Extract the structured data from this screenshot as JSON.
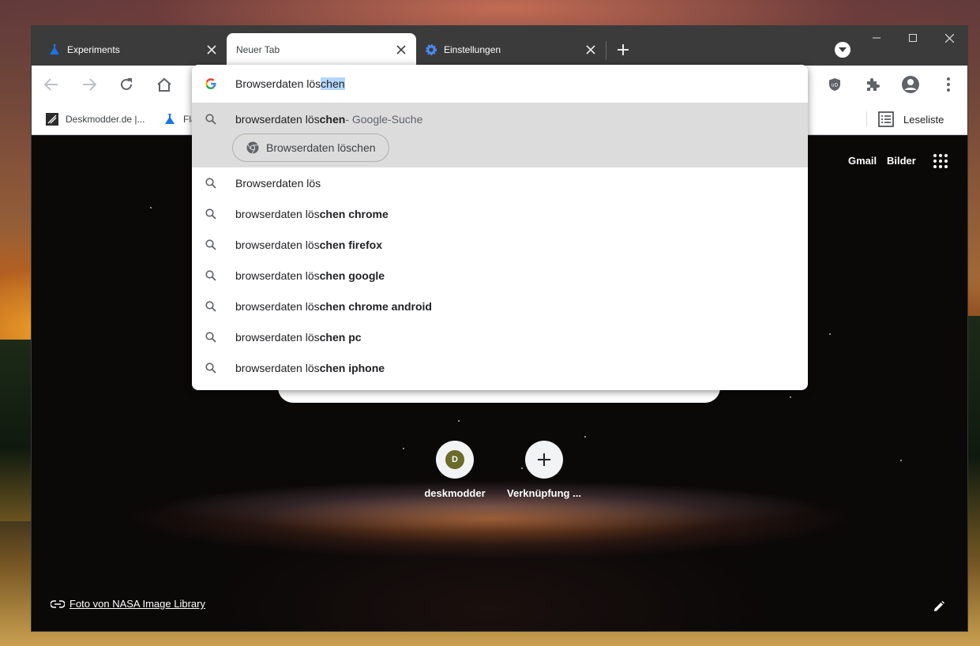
{
  "tabs": [
    {
      "title": "Experiments",
      "icon": "flask-icon"
    },
    {
      "title": "Neuer Tab",
      "icon": ""
    },
    {
      "title": "Einstellungen",
      "icon": "gear-icon"
    }
  ],
  "bookmarks": [
    {
      "label": "Deskmodder.de |...",
      "icon": "deskmodder-icon"
    },
    {
      "label": "Fla",
      "icon": "flask-icon"
    }
  ],
  "reading_list": {
    "label": "Leseliste"
  },
  "omnibox": {
    "typed": "Browserdaten lös",
    "autocomplete": "chen",
    "suggestions_top": {
      "prefix": "browserdaten lös",
      "bold": "chen",
      "suffix": " - Google-Suche"
    },
    "action_chip": "Browserdaten löschen",
    "suggestions": [
      {
        "prefix": "Browserdaten lös",
        "bold": ""
      },
      {
        "prefix": "browserdaten lös",
        "bold": "chen chrome"
      },
      {
        "prefix": "browserdaten lös",
        "bold": "chen firefox"
      },
      {
        "prefix": "browserdaten lös",
        "bold": "chen google"
      },
      {
        "prefix": "browserdaten lös",
        "bold": "chen chrome android"
      },
      {
        "prefix": "browserdaten lös",
        "bold": "chen pc"
      },
      {
        "prefix": "browserdaten lös",
        "bold": "chen iphone"
      }
    ]
  },
  "ntp": {
    "gmail": "Gmail",
    "images": "Bilder",
    "tiles": [
      {
        "label": "deskmodder",
        "avatar": "D"
      },
      {
        "label": "Verknüpfung ..."
      }
    ],
    "attribution": "Foto von NASA Image Library"
  },
  "colors": {
    "accent_blue": "#1a73e8",
    "tab_strip": "#3b3b3b",
    "highlight": "#dcdcdc"
  }
}
